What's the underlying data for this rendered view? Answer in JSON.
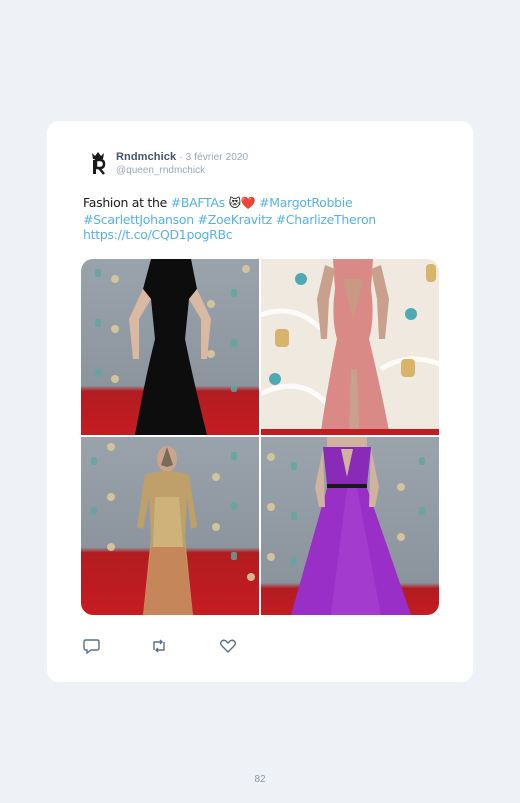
{
  "tweet": {
    "author_name": "Rndmchick",
    "date": "· 3 février 2020",
    "handle": "@queen_rndmchick",
    "text_prefix": "Fashion at the ",
    "hashtag_baftas": "#BAFTAs",
    "emoji": "😻❤️",
    "hashtag_line1_2": "#MargotRobbie",
    "hashtags_line2": "#ScarlettJohanson #ZoeKravitz #CharlizeTheron",
    "url": "https://t.co/CQD1pogRBc"
  },
  "photos": [
    {
      "name": "photo-black-gown"
    },
    {
      "name": "photo-pink-feather-gown"
    },
    {
      "name": "photo-gold-sequin-gown"
    },
    {
      "name": "photo-purple-gown"
    }
  ],
  "actions": {
    "reply_icon": "reply-icon",
    "retweet_icon": "retweet-icon",
    "like_icon": "heart-icon"
  },
  "colors": {
    "link": "#55b2e6",
    "name": "#42566c",
    "muted": "#9aa8b6",
    "background": "#eef1f5"
  },
  "page_number": "82"
}
